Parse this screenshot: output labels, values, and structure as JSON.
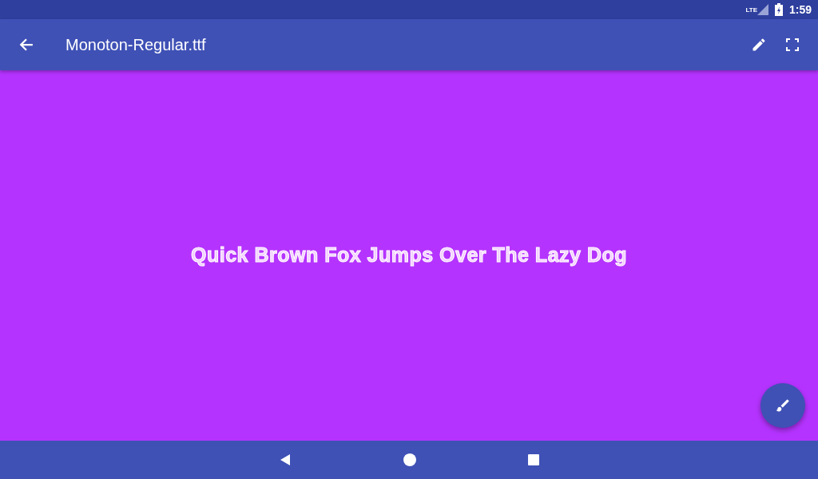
{
  "status_bar": {
    "network": "LTE",
    "time": "1:59"
  },
  "app_bar": {
    "title": "Monoton-Regular.ttf"
  },
  "preview": {
    "sample_text": "Quick Brown Fox Jumps Over The Lazy Dog"
  }
}
